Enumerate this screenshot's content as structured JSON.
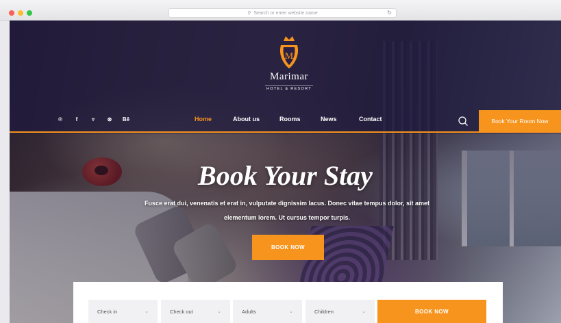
{
  "browser": {
    "address_placeholder": "Search or enter website name"
  },
  "brand": {
    "name": "Marimar",
    "tagline": "HOTEL & RESORT",
    "crest_letter": "M"
  },
  "social": [
    {
      "icon": "pinterest-icon",
      "glyph": "℗"
    },
    {
      "icon": "facebook-icon",
      "glyph": "f"
    },
    {
      "icon": "twitter-icon",
      "glyph": "🐦"
    },
    {
      "icon": "dribbble-icon",
      "glyph": "⊛"
    },
    {
      "icon": "behance-icon",
      "glyph": "Bē"
    }
  ],
  "nav": {
    "home": "Home",
    "about": "About us",
    "rooms": "Rooms",
    "news": "News",
    "contact": "Contact",
    "book_room": "Book Your Room Now"
  },
  "hero": {
    "title": "Book Your Stay",
    "description": "Fusce erat dui, venenatis et erat in, vulputate dignissim lacus. Donec vitae tempus dolor, sit amet elementum lorem. Ut cursus tempor turpis.",
    "button": "BOOK NOW"
  },
  "booking": {
    "check_in": "Check in",
    "check_out": "Check out",
    "adults": "Adults",
    "children": "Children",
    "button": "BOOK NOW"
  },
  "colors": {
    "accent": "#f7941d",
    "header_bg": "#1e193c"
  }
}
